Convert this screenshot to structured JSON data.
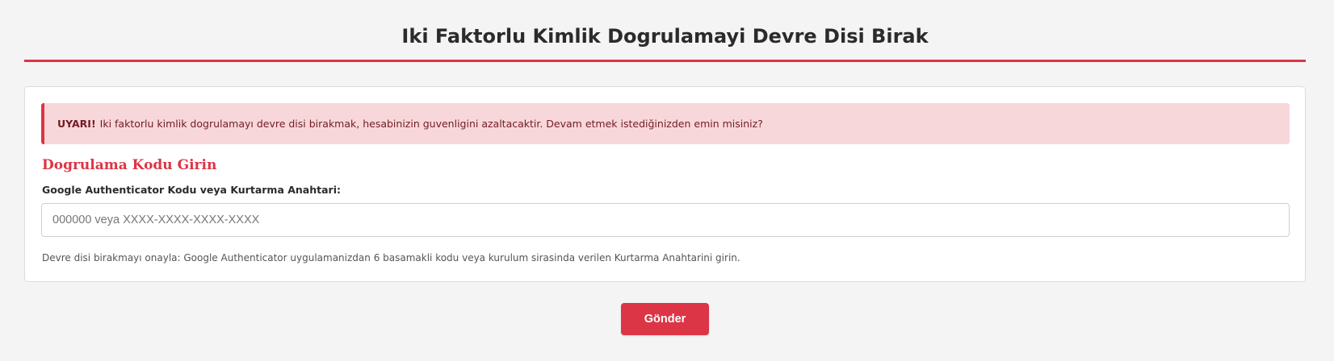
{
  "page": {
    "title": "Iki Faktorlu Kimlik Dogrulamayi Devre Disi Birak"
  },
  "alert": {
    "label": "UYARI!",
    "message": "Iki faktorlu kimlik dogrulamayı devre disi birakmak, hesabinizin guvenligini azaltacaktir. Devam etmek istediğinizden emin misiniz?"
  },
  "form": {
    "section_title": "Dogrulama Kodu Girin",
    "field_label": "Google Authenticator Kodu veya Kurtarma Anahtari:",
    "input_value": "",
    "input_placeholder": "000000 veya XXXX-XXXX-XXXX-XXXX",
    "help_text": "Devre disi birakmayı onayla: Google Authenticator uygulamanizdan 6 basamakli kodu veya kurulum sirasinda verilen Kurtarma Anahtarini girin."
  },
  "actions": {
    "submit_label": "Gönder"
  },
  "colors": {
    "accent": "#dc3545",
    "alert_background": "#f8d7da",
    "alert_text": "#721c24",
    "page_background": "#f4f4f4"
  }
}
